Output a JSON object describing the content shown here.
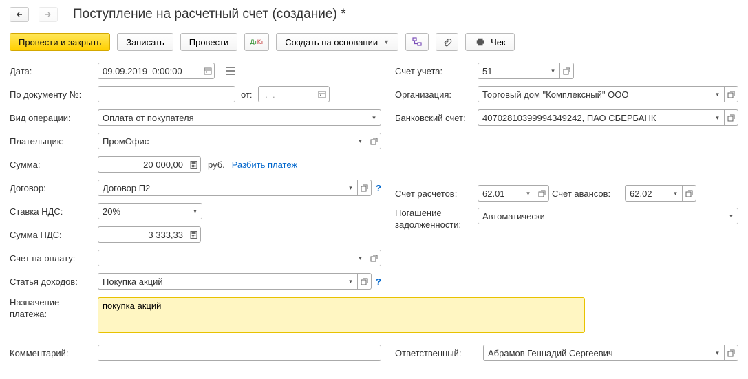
{
  "title": "Поступление на расчетный счет (создание) *",
  "toolbar": {
    "post_close": "Провести и закрыть",
    "write": "Записать",
    "post": "Провести",
    "create_based": "Создать на основании",
    "cheque": "Чек"
  },
  "left": {
    "date_label": "Дата:",
    "date_value": "09.09.2019  0:00:00",
    "doc_num_label": "По документу №:",
    "doc_num_value": "",
    "from_label": "от:",
    "from_value": " .  .    ",
    "op_label": "Вид операции:",
    "op_value": "Оплата от покупателя",
    "payer_label": "Плательщик:",
    "payer_value": "ПромОфис",
    "sum_label": "Сумма:",
    "sum_value": "20 000,00",
    "currency": "руб.",
    "split_link": "Разбить платеж",
    "contract_label": "Договор:",
    "contract_value": "Договор П2",
    "vat_rate_label": "Ставка НДС:",
    "vat_rate_value": "20%",
    "vat_sum_label": "Сумма НДС:",
    "vat_sum_value": "3 333,33",
    "invoice_label": "Счет на оплату:",
    "invoice_value": "",
    "income_label": "Статья доходов:",
    "income_value": "Покупка акций",
    "purpose_label": "Назначение платежа:",
    "purpose_value": "покупка акций",
    "comment_label": "Комментарий:",
    "comment_value": ""
  },
  "right": {
    "account_label": "Счет учета:",
    "account_value": "51",
    "org_label": "Организация:",
    "org_value": "Торговый дом \"Комплексный\" ООО",
    "bank_label": "Банковский счет:",
    "bank_value": "40702810399994349242, ПАО СБЕРБАНК",
    "settle_acc_label": "Счет расчетов:",
    "settle_acc_value": "62.01",
    "advance_acc_label": "Счет авансов:",
    "advance_acc_value": "62.02",
    "debt_label": "Погашение задолженности:",
    "debt_value": "Автоматически",
    "responsible_label": "Ответственный:",
    "responsible_value": "Абрамов Геннадий Сергеевич"
  }
}
